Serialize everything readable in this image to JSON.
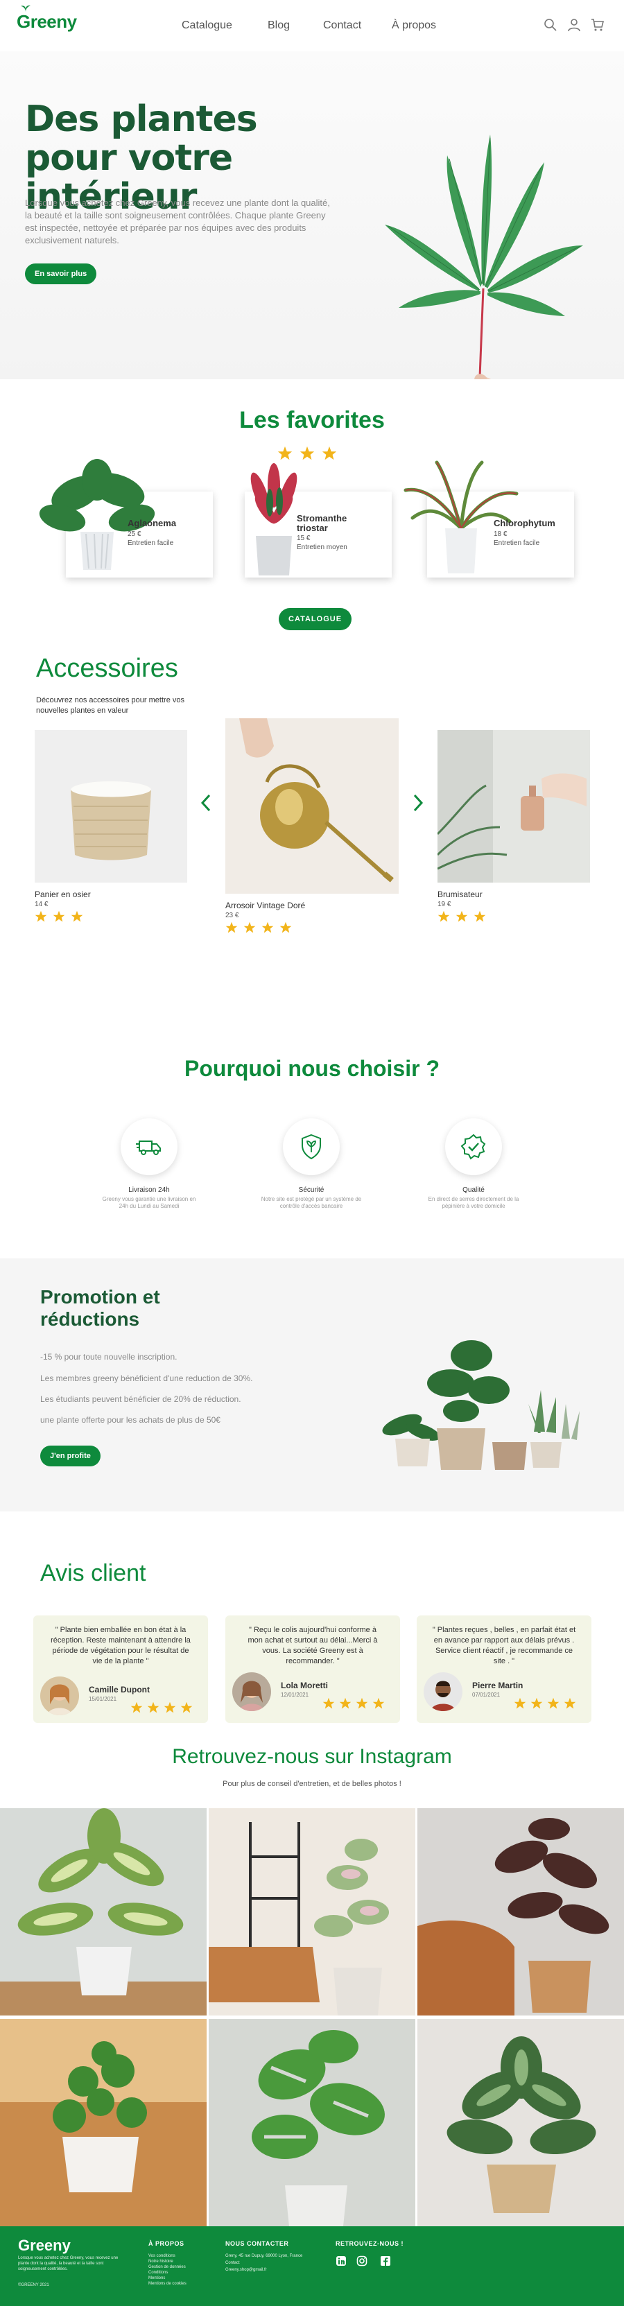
{
  "brand": {
    "name": "Greeny",
    "color": "#0e8a3c",
    "dark_green": "#1b5a35",
    "star_color": "#f2b41a"
  },
  "nav": {
    "items": [
      "Catalogue",
      "Blog",
      "Contact",
      "À propos"
    ]
  },
  "header_icons": [
    "search-icon",
    "user-icon",
    "cart-icon"
  ],
  "hero": {
    "title": "Des plantes pour votre intérieur",
    "text": "Lorsque vous achetez chez Greeny, vous recevez une plante dont la qualité, la beauté et la taille sont soigneusement contrôlées. Chaque plante Greeny est inspectée, nettoyée et préparée par nos équipes avec des produits exclusivement naturels.",
    "button": "En savoir plus"
  },
  "favorites": {
    "title": "Les favorites",
    "rating": 3,
    "items": [
      {
        "name": "Aglaonema",
        "price": "25 €",
        "care": "Entretien facile"
      },
      {
        "name": "Stromanthe triostar",
        "price": "15 €",
        "care": "Entretien moyen"
      },
      {
        "name": "Chlorophytum",
        "price": "18 €",
        "care": "Entretien facile"
      }
    ],
    "button": "CATALOGUE"
  },
  "accessories": {
    "title": "Accessoires",
    "subtitle": "Découvrez nos accessoires pour mettre vos nouvelles plantes en valeur",
    "items": [
      {
        "name": "Panier en osier",
        "price": "14 €",
        "rating": 3
      },
      {
        "name": "Arrosoir Vintage Doré",
        "price": "23 €",
        "rating": 4
      },
      {
        "name": "Brumisateur",
        "price": "19 €",
        "rating": 3
      }
    ]
  },
  "why": {
    "title": "Pourquoi nous choisir ?",
    "items": [
      {
        "title": "Livraison 24h",
        "text": "Greeny vous garantie une livraison en 24h du Lundi au Samedi"
      },
      {
        "title": "Sécurité",
        "text": "Notre site est protégé par un système de contrôle d'accès bancaire"
      },
      {
        "title": "Qualité",
        "text": "En direct de serres directement de la pépinière à votre domicile"
      }
    ]
  },
  "promotion": {
    "title": "Promotion et réductions",
    "lines": [
      "-15 % pour toute nouvelle inscription.",
      "Les membres greeny bénéficient d'une reduction de 30%.",
      "Les étudiants peuvent bénéficier de 20% de réduction.",
      "une plante offerte pour les achats de plus de 50€"
    ],
    "button": "J'en profite"
  },
  "reviews": {
    "title": "Avis client",
    "items": [
      {
        "text": "\" Plante bien emballée en bon état à la réception. Reste maintenant à attendre la période de végétation pour le résultat de vie de la plante \"",
        "name": "Camille Dupont",
        "date": "15/01/2021",
        "rating": 4
      },
      {
        "text": "\" Reçu le colis aujourd'hui conforme à mon achat et surtout au délai...Merci à vous. La société Greeny est à recommander. \"",
        "name": "Lola Moretti",
        "date": "12/01/2021",
        "rating": 4
      },
      {
        "text": "\" Plantes reçues , belles , en parfait état et en avance par rapport aux délais prévus . Service client réactif , je recommande ce site . \"",
        "name": "Pierre Martin",
        "date": "07/01/2021",
        "rating": 4
      }
    ]
  },
  "instagram": {
    "title": "Retrouvez-nous sur Instagram",
    "subtitle": "Pour plus de conseil d'entretien, et de belles photos !"
  },
  "footer": {
    "logo": "Greeny",
    "description": "Lorsque vous achetez chez Greeny, vous recevez une plante dont la qualité, la beauté et la taille sont soigneusement contrôlées.",
    "copyright": "©GREENY 2021",
    "about_title": "À PROPOS",
    "about_links": [
      "Vos conditions",
      "Notre histoire",
      "Gestion de données",
      "Conditions",
      "Mentions",
      "Mentions de cookies"
    ],
    "contact_title": "NOUS CONTACTER",
    "contact_lines": [
      "Greny, 45 rue Dupuy, 69000 Lyon, France",
      "Contact",
      "Greeny.shop@gmail.fr"
    ],
    "social_title": "RETROUVEZ-NOUS !",
    "social_icons": [
      "linkedin-icon",
      "instagram-icon",
      "facebook-icon"
    ]
  }
}
